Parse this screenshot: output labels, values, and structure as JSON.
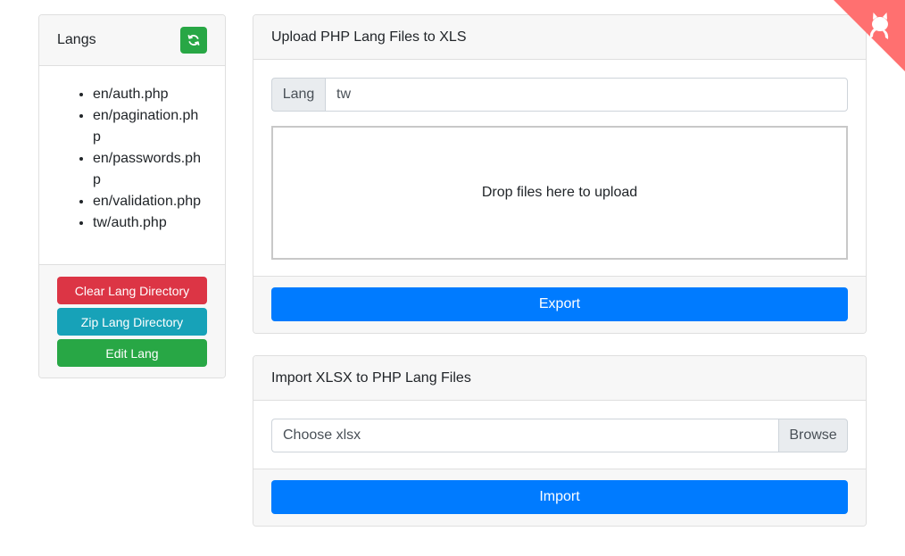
{
  "sidebar": {
    "title": "Langs",
    "refresh_icon": "refresh-icon",
    "files": [
      "en/auth.php",
      "en/pagination.php",
      "en/passwords.php",
      "en/validation.php",
      "tw/auth.php"
    ],
    "buttons": {
      "clear": "Clear Lang Directory",
      "zip": "Zip Lang Directory",
      "edit": "Edit Lang"
    }
  },
  "upload": {
    "title": "Upload PHP Lang Files to XLS",
    "lang_label": "Lang",
    "lang_value": "tw",
    "dropzone_text": "Drop files here to upload",
    "export_label": "Export"
  },
  "import": {
    "title": "Import XLSX to PHP Lang Files",
    "file_placeholder": "Choose xlsx",
    "browse_label": "Browse",
    "import_label": "Import"
  },
  "colors": {
    "primary": "#007bff",
    "success": "#28a745",
    "danger": "#dc3545",
    "info": "#17a2b8",
    "github_corner": "#ff7070"
  },
  "github_icon": "octocat-icon"
}
